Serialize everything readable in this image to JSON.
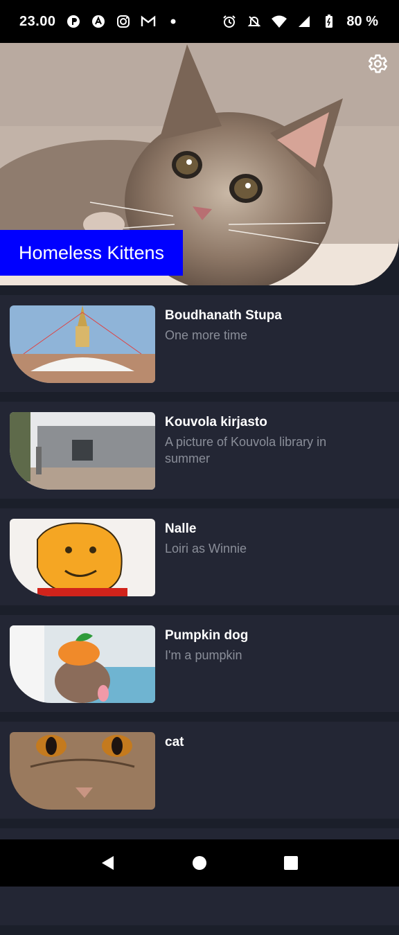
{
  "status_bar": {
    "time": "23.00",
    "battery": "80 %",
    "left_icons": [
      "pinterest-like-icon",
      "arrow-circle-icon",
      "instagram-icon",
      "gmail-icon",
      "dot-icon"
    ],
    "right_icons": [
      "alarm-icon",
      "bell-off-icon",
      "wifi-icon",
      "signal-icon",
      "battery-icon"
    ]
  },
  "hero": {
    "title": "Homeless Kittens",
    "settings_icon": "gear-icon",
    "accent_color": "#0000ff"
  },
  "items": [
    {
      "title": "Boudhanath Stupa",
      "subtitle": "One more time"
    },
    {
      "title": "Kouvola kirjasto",
      "subtitle": "A picture of Kouvola library in summer"
    },
    {
      "title": "Nalle",
      "subtitle": "Loiri as Winnie"
    },
    {
      "title": "Pumpkin dog",
      "subtitle": "I'm a pumpkin"
    },
    {
      "title": "cat",
      "subtitle": ""
    }
  ],
  "nav_bar": {
    "buttons": [
      "back-icon",
      "home-icon",
      "recents-icon"
    ]
  },
  "colors": {
    "background": "#1b1f2a",
    "card": "#232634",
    "title_text": "#ffffff",
    "subtitle_text": "#8a8e99"
  }
}
